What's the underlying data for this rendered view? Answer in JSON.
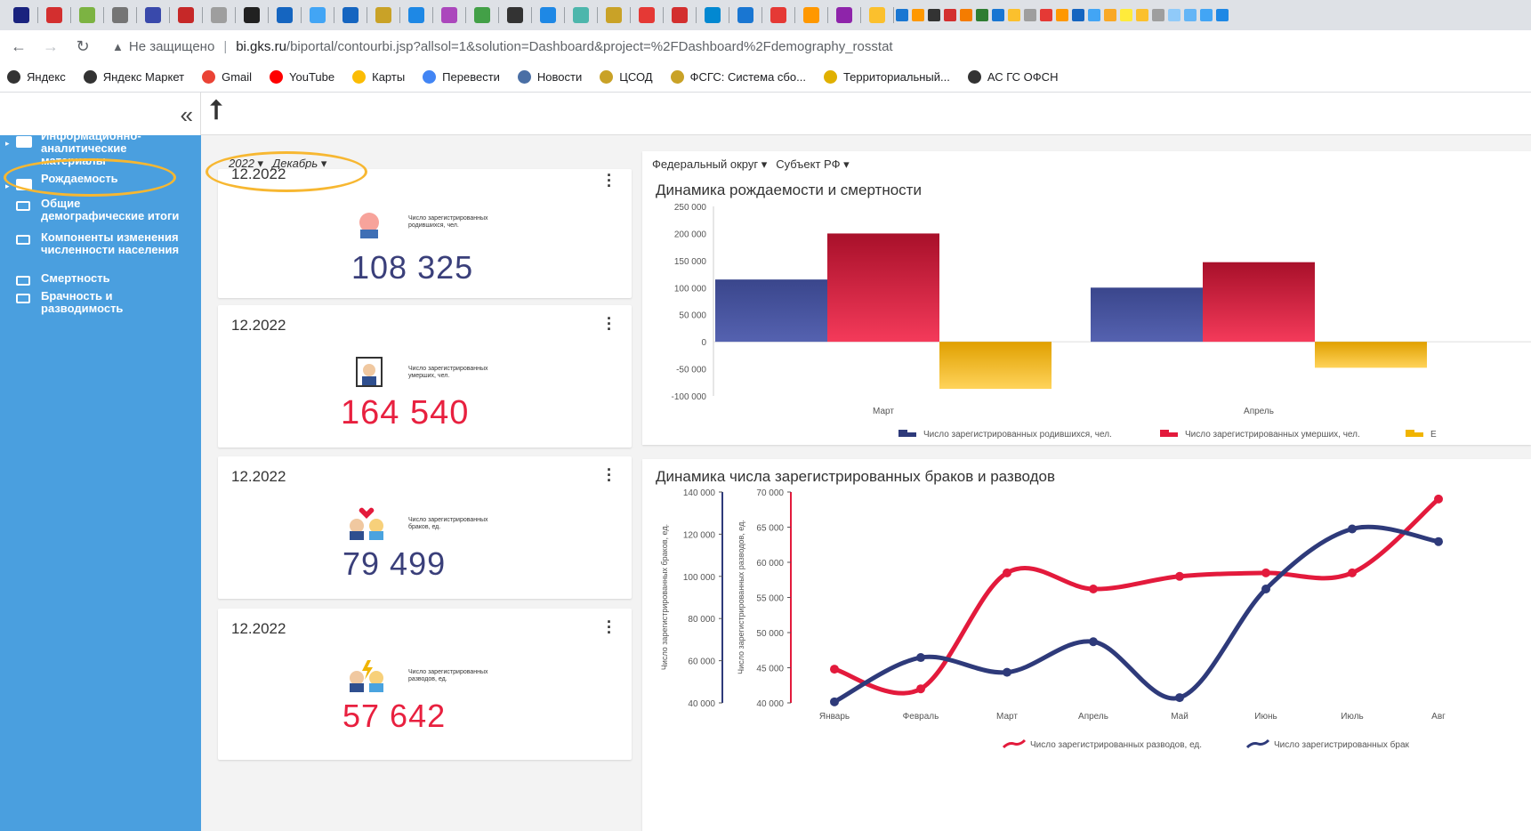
{
  "browser": {
    "not_secure": "Не защищено",
    "url_domain": "bi.gks.ru",
    "url_path": "/biportal/contourbi.jsp?allsol=1&solution=Dashboard&project=%2FDashboard%2Fdemography_rosstat",
    "bookmarks": [
      {
        "label": "Яндекс",
        "color": "#333333"
      },
      {
        "label": "Яндекс Маркет",
        "color": "#333333"
      },
      {
        "label": "Gmail",
        "color": "#ea4335"
      },
      {
        "label": "YouTube",
        "color": "#ff0000"
      },
      {
        "label": "Карты",
        "color": "#fbbc04"
      },
      {
        "label": "Перевести",
        "color": "#4285f4"
      },
      {
        "label": "Новости",
        "color": "#4a6fa5"
      },
      {
        "label": "ЦСОД",
        "color": "#c9a227"
      },
      {
        "label": "ФСГС: Система сбо...",
        "color": "#c9a227"
      },
      {
        "label": "Территориальный...",
        "color": "#e0b000"
      },
      {
        "label": "АС ГС ОФСН",
        "color": "#333333"
      }
    ]
  },
  "sidebar": {
    "collapse_glyph": "«",
    "items": [
      {
        "label": "Информационно-аналитические материалы",
        "icon": "folder"
      },
      {
        "label": "Рождаемость",
        "icon": "folder"
      },
      {
        "label": "Общие демографические итоги",
        "icon": "monitor"
      },
      {
        "label": "Компоненты изменения численности населения",
        "icon": "monitor"
      },
      {
        "label": "Смертность",
        "icon": "monitor"
      },
      {
        "label": "Брачность и разводимость",
        "icon": "monitor"
      }
    ]
  },
  "filters": {
    "year": "2022",
    "month": "Декабрь",
    "district": "Федеральный округ",
    "subject": "Субъект РФ"
  },
  "kpis": [
    {
      "date": "12.2022",
      "label": "Число зарегистрированных родившихся, чел.",
      "value": "108 325",
      "color": "#3a3f7a"
    },
    {
      "date": "12.2022",
      "label": "Число зарегистрированных умерших, чел.",
      "value": "164 540",
      "color": "#e8203f"
    },
    {
      "date": "12.2022",
      "label": "Число зарегистрированных браков, ед.",
      "value": "79 499",
      "color": "#3a3f7a"
    },
    {
      "date": "12.2022",
      "label": "Число зарегистрированных разводов, ед.",
      "value": "57 642",
      "color": "#e8203f"
    }
  ],
  "colors": {
    "navy": "#2e3a7a",
    "red": "#e31a3c",
    "gold": "#f0b400",
    "sidebar": "#4a9fdf",
    "highlight": "#f7b731"
  },
  "chart_data": [
    {
      "type": "bar",
      "title": "Динамика рождаемости и смертности",
      "categories": [
        "Март",
        "Апрель"
      ],
      "series": [
        {
          "name": "Число зарегистрированных родившихся, чел.",
          "values": [
            115000,
            100000
          ],
          "color": "#2e3a7a"
        },
        {
          "name": "Число зарегистрированных умерших, чел.",
          "values": [
            200000,
            147000
          ],
          "color": "#e31a3c"
        },
        {
          "name": "Е",
          "values": [
            -87000,
            -48000
          ],
          "color": "#f0b400"
        }
      ],
      "yticks": [
        "250 000",
        "200 000",
        "150 000",
        "100 000",
        "50 000",
        "0",
        "-50 000",
        "-100 000"
      ],
      "ylim": [
        -100000,
        250000
      ],
      "legend": "bottom"
    },
    {
      "type": "line",
      "title": "Динамика числа зарегистрированных браков и разводов",
      "categories": [
        "Январь",
        "Февраль",
        "Март",
        "Апрель",
        "Май",
        "Июнь",
        "Июль",
        "Авг"
      ],
      "y1label": "Число зарегистрированных браков, ед.",
      "y2label": "Число зарегистрированных разводов, ед.",
      "y1ticks": [
        "140 000",
        "120 000",
        "100 000",
        "80 000",
        "60 000",
        "40 000"
      ],
      "y2ticks": [
        "70 000",
        "65 000",
        "60 000",
        "55 000",
        "50 000",
        "45 000",
        "40 000"
      ],
      "y1lim": [
        40000,
        140000
      ],
      "y2lim": [
        40000,
        70000
      ],
      "series": [
        {
          "name": "Число зарегистрированных разводов, ед.",
          "axis": "y2",
          "values": [
            44800,
            42000,
            58500,
            56200,
            58000,
            58500,
            58500,
            69000
          ],
          "color": "#e31a3c"
        },
        {
          "name": "Число зарегистрированных брак",
          "axis": "y1",
          "values": [
            40500,
            61500,
            54500,
            69000,
            42500,
            94000,
            122500,
            116500
          ],
          "color": "#2e3a7a"
        }
      ],
      "legend": "bottom"
    }
  ]
}
